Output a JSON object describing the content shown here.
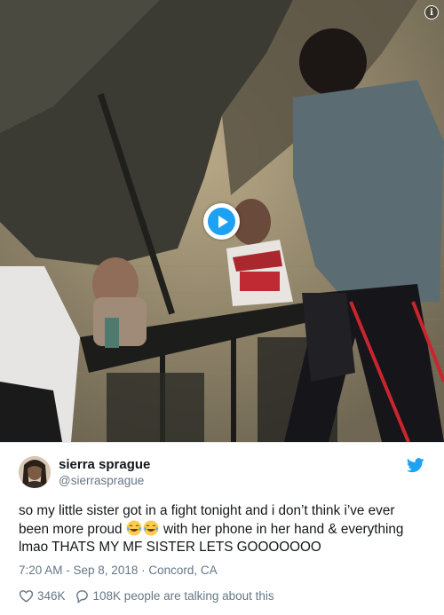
{
  "media": {
    "info_icon": "info-icon",
    "play_icon": "play-icon"
  },
  "author": {
    "display_name": "sierra sprague",
    "handle": "@sierrasprague"
  },
  "tweet": {
    "text_before_emoji": "so my little sister got in a fight tonight and i don’t think i’ve ever been more proud ",
    "emoji": "face-with-tears-of-joy",
    "text_after_emoji": " with her phone in her hand & everything lmao THATS MY MF SISTER LETS GOOOOOOO",
    "timestamp": "7:20 AM - Sep 8, 2018 · Concord, CA"
  },
  "actions": {
    "likes": "346K",
    "replies_text": "108K people are talking about this"
  },
  "colors": {
    "brand": "#1da1f2",
    "text": "#14171a",
    "secondary": "#657786",
    "border": "#e1e8ed"
  }
}
